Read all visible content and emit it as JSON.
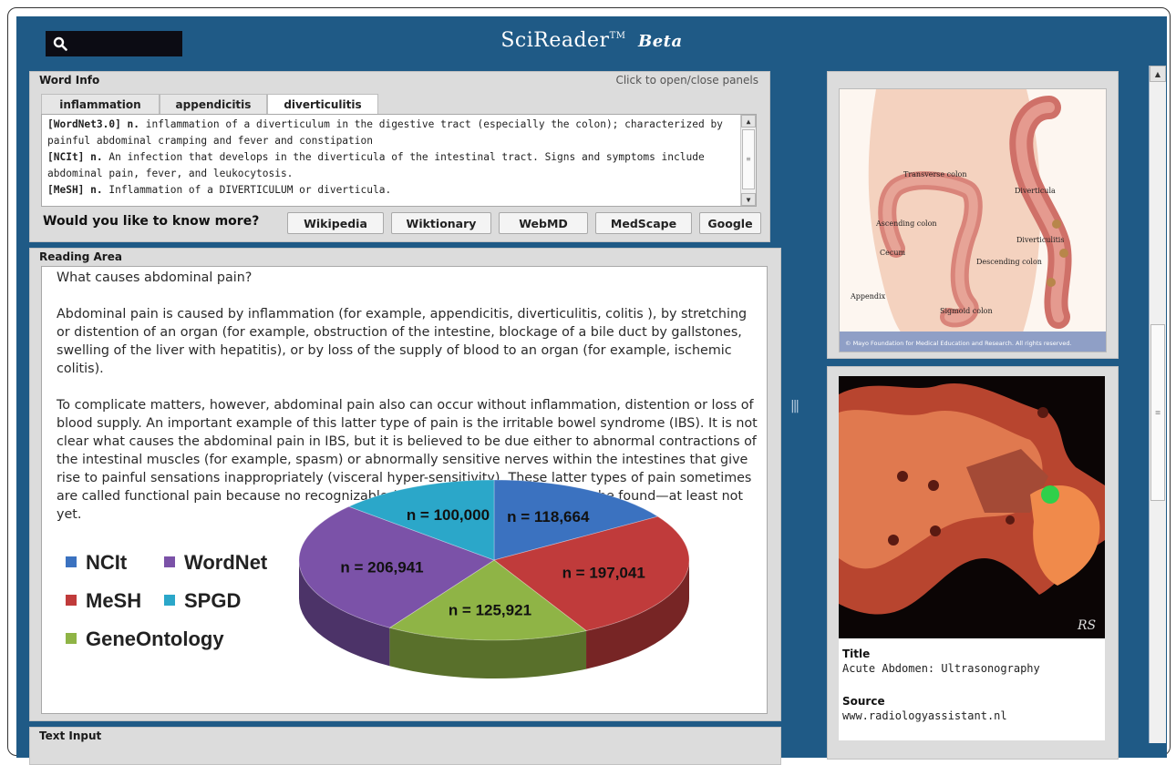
{
  "header": {
    "app_name": "SciReader",
    "trademark": "TM",
    "badge": "Beta",
    "search_icon": "search-icon"
  },
  "word_info": {
    "title": "Word Info",
    "hint": "Click to open/close panels",
    "tabs": [
      "inflammation",
      "appendicitis",
      "diverticulitis"
    ],
    "active_tab": "diverticulitis",
    "definitions": [
      {
        "source": "[WordNet3.0] n.",
        "text": " inflammation of a diverticulum in the digestive tract (especially the colon); characterized by painful abdominal cramping and fever and constipation"
      },
      {
        "source": "[NCIt] n.",
        "text": " An infection that develops in the diverticula of the intestinal tract. Signs and symptoms include abdominal pain, fever, and leukocytosis."
      },
      {
        "source": "[MeSH] n.",
        "text": " Inflammation of a DIVERTICULUM or diverticula."
      }
    ],
    "know_more": "Would you like to know more?",
    "links": [
      "Wikipedia",
      "Wiktionary",
      "WebMD",
      "MedScape",
      "Google"
    ]
  },
  "reading_area": {
    "title": "Reading Area",
    "paragraphs": [
      "What causes abdominal pain?",
      "Abdominal pain is caused by inflammation (for example, appendicitis, diverticulitis, colitis ), by stretching or distention of an organ (for example, obstruction of the intestine, blockage of a bile duct by gallstones, swelling of the liver with hepatitis), or by loss of the supply of blood to an organ (for example, ischemic colitis).",
      "To complicate matters, however, abdominal pain also can occur without inflammation, distention or loss of blood supply. An important example of this latter type of pain is the irritable bowel syndrome (IBS). It is not clear what causes the abdominal pain in IBS, but it is believed to be due either to abnormal contractions of the intestinal muscles (for example, spasm) or abnormally sensitive nerves within the intestines that give rise to painful sensations inappropriately (visceral hyper-sensitivity). These latter types of pain sometimes are called functional pain because no recognizable (visible) cause for the pain can be found—at least not yet."
    ]
  },
  "text_input": {
    "title": "Text Input"
  },
  "chart_data": {
    "type": "pie",
    "title": "",
    "series": [
      {
        "name": "NCIt",
        "value": 118664,
        "label": "n = 118,664",
        "color": "#3b72c0"
      },
      {
        "name": "MeSH",
        "value": 197041,
        "label": "n = 197,041",
        "color": "#c03b3b"
      },
      {
        "name": "GeneOntology",
        "value": 125921,
        "label": "n = 125,921",
        "color": "#8fb446"
      },
      {
        "name": "WordNet",
        "value": 206941,
        "label": "n = 206,941",
        "color": "#7b52a8"
      },
      {
        "name": "SPGD",
        "value": 100000,
        "label": "n = 100,000",
        "color": "#2ba7c9"
      }
    ],
    "legend_position": "left",
    "legend_order": [
      "NCIt",
      "WordNet",
      "MeSH",
      "SPGD",
      "GeneOntology"
    ]
  },
  "images": {
    "colon_diagram": {
      "labels": [
        "Transverse colon",
        "Diverticula",
        "Ascending colon",
        "Diverticulitis",
        "Cecum",
        "Descending colon",
        "Appendix",
        "Sigmoid colon"
      ],
      "caption": "© Mayo Foundation for Medical Education and Research. All rights reserved."
    },
    "ultrasound": {
      "watermark": "RS",
      "title_label": "Title",
      "title_value": "Acute Abdomen: Ultrasonography",
      "source_label": "Source",
      "source_value": "www.radiologyassistant.nl"
    }
  }
}
